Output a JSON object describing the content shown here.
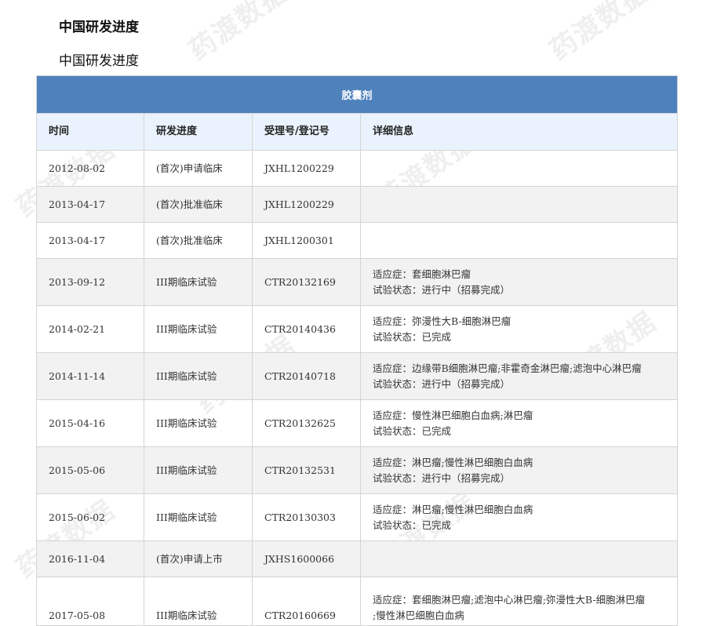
{
  "headings": {
    "title_bold": "中国研发进度",
    "title_plain": "中国研发进度"
  },
  "watermark": {
    "text": "药渡数据"
  },
  "table": {
    "caption": "胶囊剂",
    "columns": [
      "时间",
      "研发进度",
      "受理号/登记号",
      "详细信息"
    ],
    "rows": [
      {
        "date": "2012-08-02",
        "stage": "(首次)申请临床",
        "number": "JXHL1200229",
        "detail1": "",
        "detail2": ""
      },
      {
        "date": "2013-04-17",
        "stage": "(首次)批准临床",
        "number": "JXHL1200229",
        "detail1": "",
        "detail2": ""
      },
      {
        "date": "2013-04-17",
        "stage": "(首次)批准临床",
        "number": "JXHL1200301",
        "detail1": "",
        "detail2": ""
      },
      {
        "date": "2013-09-12",
        "stage": "III期临床试验",
        "number": "CTR20132169",
        "detail1": "适应症：套细胞淋巴瘤",
        "detail2": "试验状态：进行中（招募完成）"
      },
      {
        "date": "2014-02-21",
        "stage": "III期临床试验",
        "number": "CTR20140436",
        "detail1": "适应症：弥漫性大B-细胞淋巴瘤",
        "detail2": "试验状态：已完成"
      },
      {
        "date": "2014-11-14",
        "stage": "III期临床试验",
        "number": "CTR20140718",
        "detail1": "适应症：边缘带B细胞淋巴瘤;非霍奇金淋巴瘤;滤泡中心淋巴瘤",
        "detail2": "试验状态：进行中（招募完成）"
      },
      {
        "date": "2015-04-16",
        "stage": "III期临床试验",
        "number": "CTR20132625",
        "detail1": "适应症：慢性淋巴细胞白血病;淋巴瘤",
        "detail2": "试验状态：已完成"
      },
      {
        "date": "2015-05-06",
        "stage": "III期临床试验",
        "number": "CTR20132531",
        "detail1": "适应症：淋巴瘤;慢性淋巴细胞白血病",
        "detail2": "试验状态：进行中（招募完成）"
      },
      {
        "date": "2015-06-02",
        "stage": "III期临床试验",
        "number": "CTR20130303",
        "detail1": "适应症：淋巴瘤;慢性淋巴细胞白血病",
        "detail2": "试验状态：已完成"
      },
      {
        "date": "2016-11-04",
        "stage": "(首次)申请上市",
        "number": "JXHS1600066",
        "detail1": "",
        "detail2": ""
      },
      {
        "date": "2017-05-08",
        "stage": "III期临床试验",
        "number": "CTR20160669",
        "detail1": "适应症：套细胞淋巴瘤;滤泡中心淋巴瘤;弥漫性大B-细胞淋巴瘤",
        "detail2": ";慢性淋巴细胞白血病"
      }
    ]
  }
}
